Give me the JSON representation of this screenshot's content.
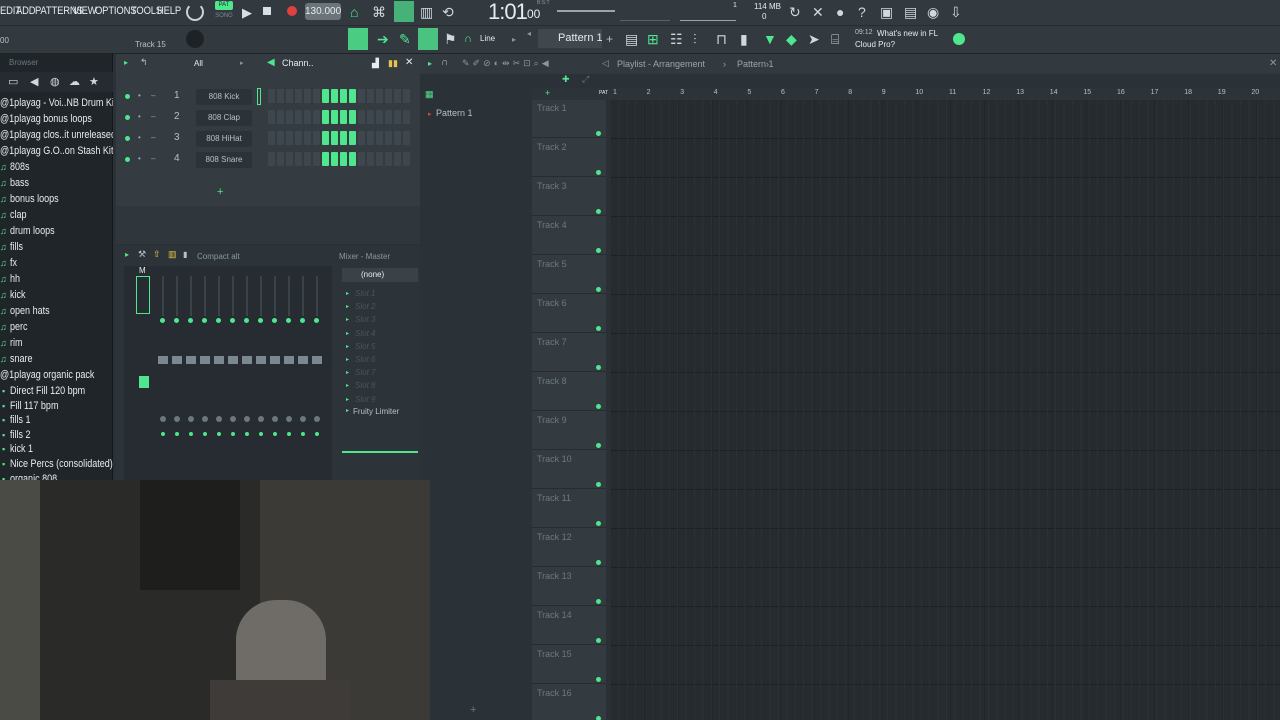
{
  "menu": {
    "edit": "EDIT",
    "add": "ADD",
    "patterns": "PATTERNS",
    "view": "VIEW",
    "options": "OPTIONS",
    "tools": "TOOLS",
    "help": "HELP"
  },
  "transport": {
    "pat": "PAT",
    "song": "SONG",
    "tempo": "130.000",
    "time": "1:01",
    "time_sub": "00",
    "bst": "B:S:T",
    "memory": "114 MB",
    "cpu": "0",
    "cpu2": "1"
  },
  "hint": {
    "track": "Track 15",
    "left_value": "00"
  },
  "toolbar2": {
    "snap": "Line",
    "pattern": "Pattern 1",
    "news_time": "09:12",
    "news_text_1": "What's new in FL",
    "news_text_2": "Cloud Pro?"
  },
  "browser": {
    "title": "Browser",
    "items": [
      "@1playag - Voi..NB Drum Kit)",
      "@1playag bonus loops",
      "@1playag clos..it unreleased",
      "@1playag G.O..on Stash Kit",
      "808s",
      "bass",
      "bonus loops",
      "clap",
      "drum loops",
      "fills",
      "fx",
      "hh",
      "kick",
      "open hats",
      "perc",
      "rim",
      "snare",
      "@1playag organic pack",
      "Direct Fill 120 bpm",
      "Fill 117 bpm",
      "fills 1",
      "fills 2",
      "kick 1",
      "Nice Percs (consolidated)",
      "organic 808"
    ]
  },
  "channel_rack": {
    "filter": "All",
    "title": "Chann..",
    "channels": [
      {
        "num": "1",
        "name": "808 Kick"
      },
      {
        "num": "2",
        "name": "808 Clap"
      },
      {
        "num": "3",
        "name": "808 HiHat"
      },
      {
        "num": "4",
        "name": "808 Snare"
      }
    ],
    "add_label": "+"
  },
  "mixer": {
    "preset": "Compact alt",
    "title": "Mixer - Master",
    "route": "(none)",
    "master_label": "M",
    "slots": [
      "Slot 1",
      "Slot 2",
      "Slot 3",
      "Slot 4",
      "Slot 5",
      "Slot 6",
      "Slot 7",
      "Slot 8",
      "Slot 9"
    ],
    "effect": "Fruity Limiter"
  },
  "playlist": {
    "title": "Playlist - Arrangement",
    "crumb": "Pattern 1",
    "pattern_item": "Pattern 1",
    "ruler": [
      "1",
      "2",
      "3",
      "4",
      "5",
      "6",
      "7",
      "8",
      "9",
      "10",
      "11",
      "12",
      "13",
      "14",
      "15",
      "16",
      "17",
      "18",
      "19",
      "20"
    ],
    "tracks": [
      "Track 1",
      "Track 2",
      "Track 3",
      "Track 4",
      "Track 5",
      "Track 6",
      "Track 7",
      "Track 8",
      "Track 9",
      "Track 10",
      "Track 11",
      "Track 12",
      "Track 13",
      "Track 14",
      "Track 15",
      "Track 16"
    ]
  },
  "colors": {
    "accent": "#4fe68e",
    "bg": "#2b3136"
  }
}
